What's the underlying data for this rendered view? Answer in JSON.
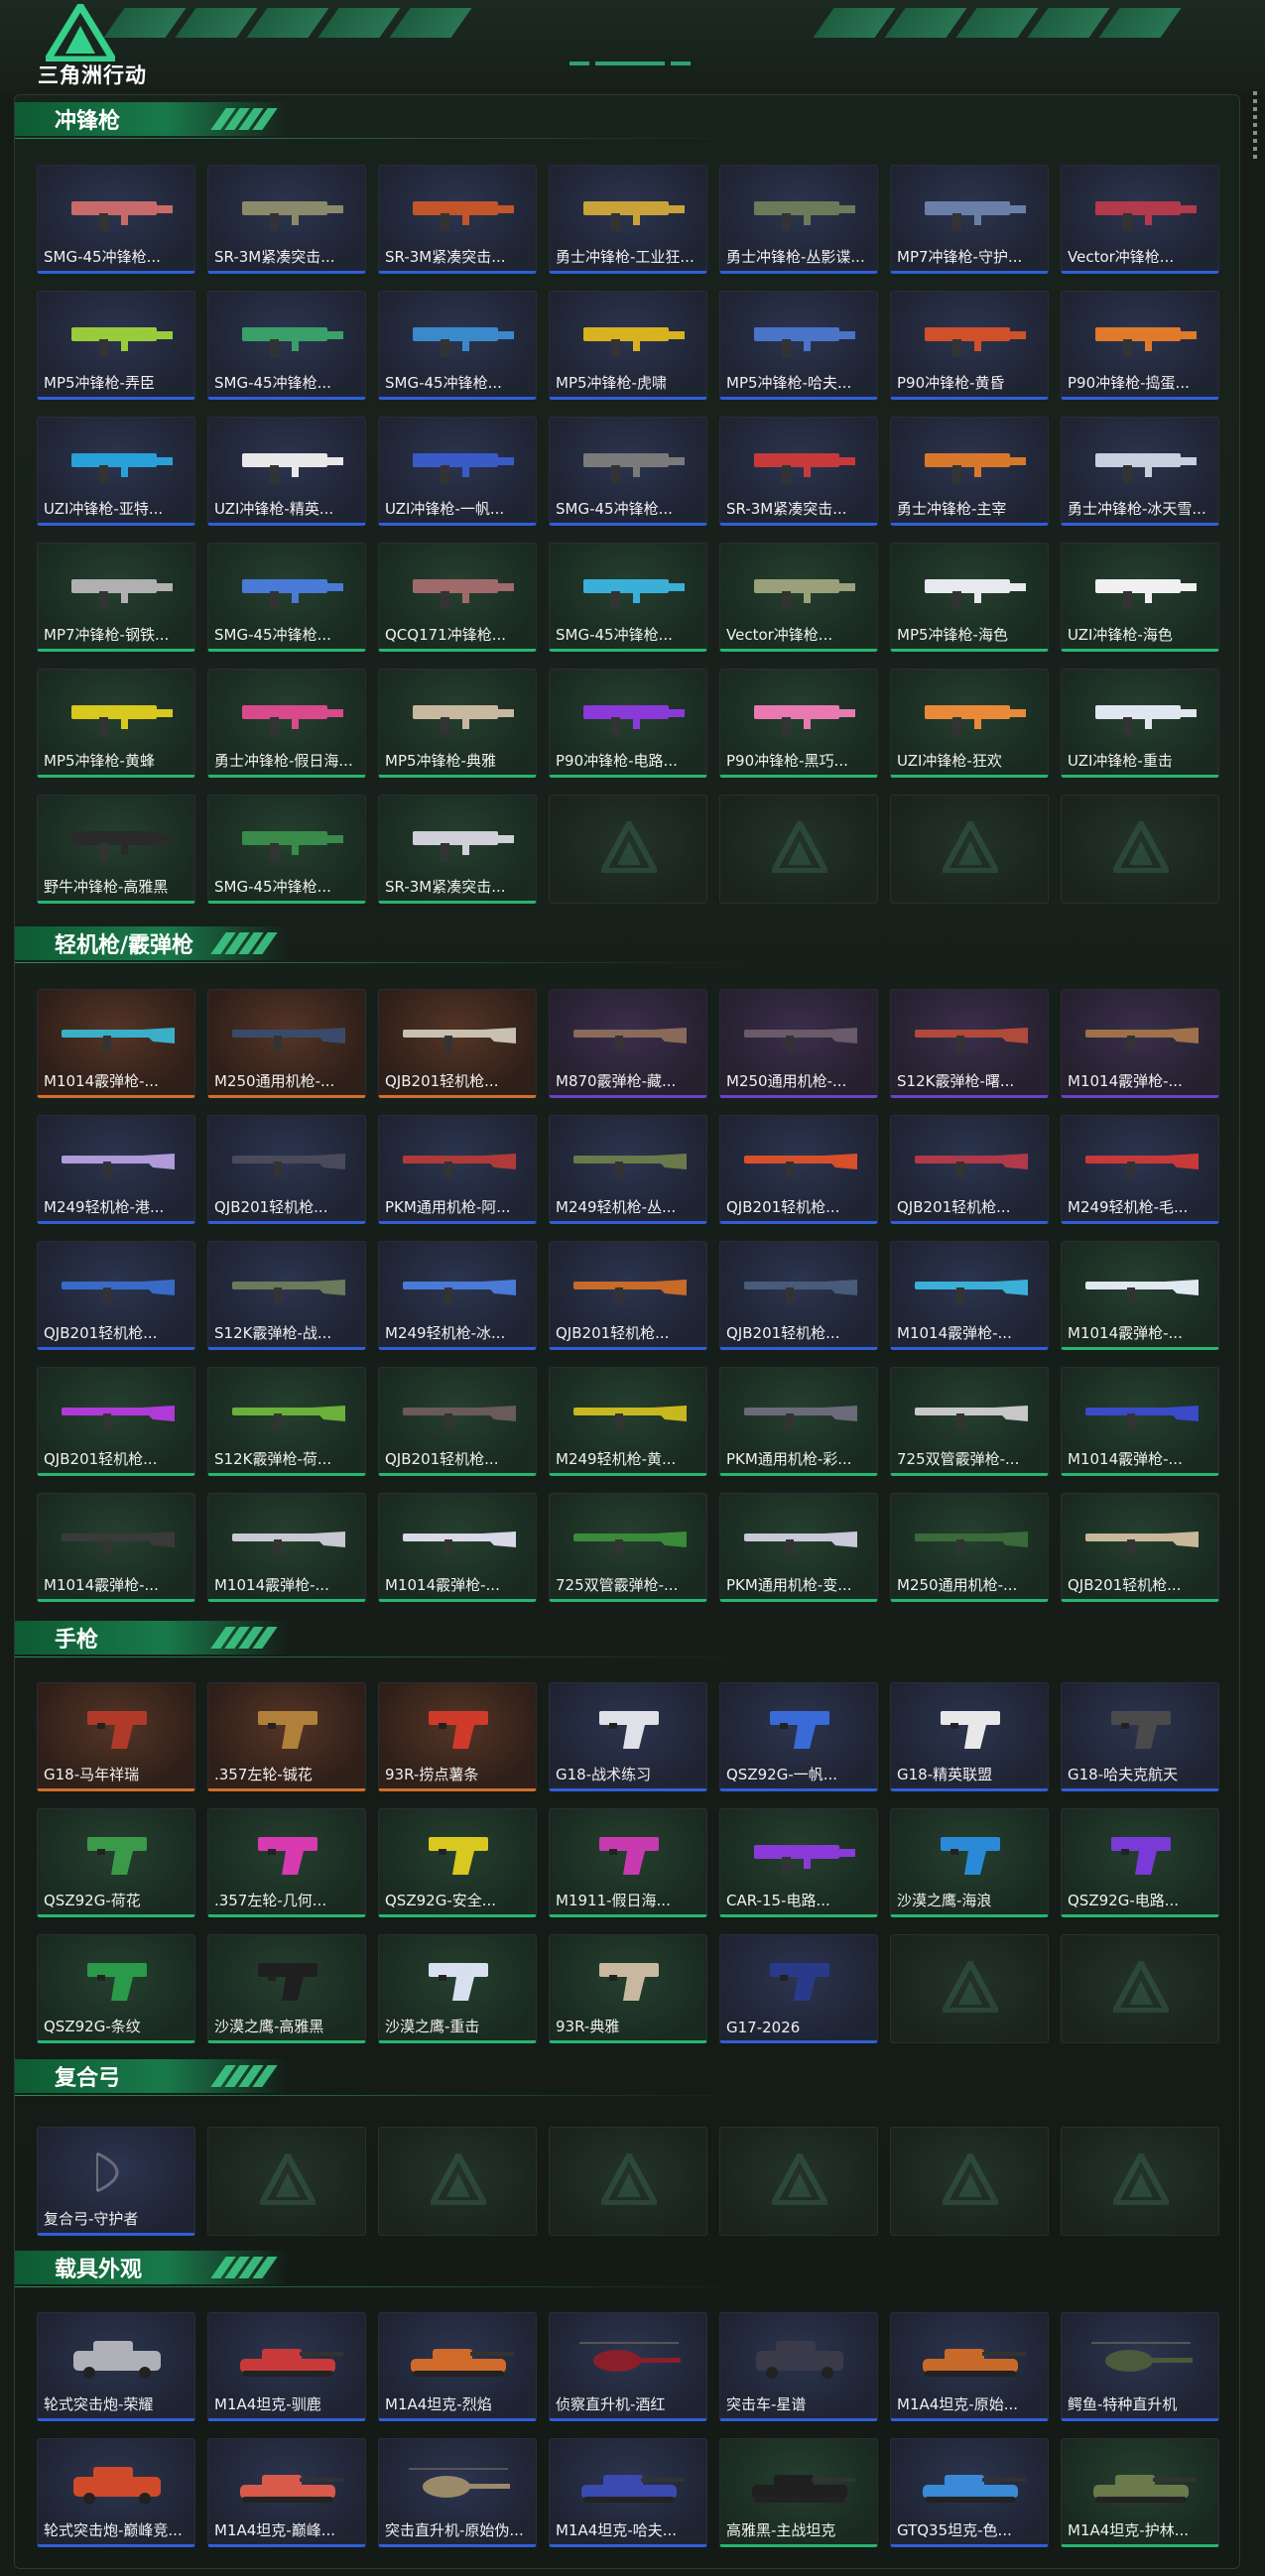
{
  "header": {
    "logo_text": "三角洲行动"
  },
  "colors": {
    "accent": "#2fa174",
    "section_bar": "#19794a",
    "rarity_purple": "#6a42c8",
    "rarity_blue": "#2f5fd8",
    "rarity_green": "#28b56f",
    "rarity_orange": "#d0702c",
    "rarity_gray": "#9a9fa6"
  },
  "sections": [
    {
      "title": "冲锋枪",
      "items": [
        {
          "label": "SMG-45冲锋枪...",
          "rarity": "blue",
          "icon": "smg-icon",
          "tint": "#c96a6a"
        },
        {
          "label": "SR-3M紧凑突击...",
          "rarity": "blue",
          "icon": "smg-icon",
          "tint": "#8a8a6a"
        },
        {
          "label": "SR-3M紧凑突击...",
          "rarity": "blue",
          "icon": "smg-icon",
          "tint": "#c2552a"
        },
        {
          "label": "勇士冲锋枪-工业狂...",
          "rarity": "blue",
          "icon": "smg-icon",
          "tint": "#c9a23a"
        },
        {
          "label": "勇士冲锋枪-丛影谍...",
          "rarity": "blue",
          "icon": "smg-icon",
          "tint": "#6c7a5a"
        },
        {
          "label": "MP7冲锋枪-守护...",
          "rarity": "blue",
          "icon": "smg-icon",
          "tint": "#6a7fa8"
        },
        {
          "label": "Vector冲锋枪...",
          "rarity": "blue",
          "icon": "smg-icon",
          "tint": "#b23a4a"
        },
        {
          "label": "MP5冲锋枪-弄臣",
          "rarity": "blue",
          "icon": "smg-icon",
          "tint": "#9acb3a"
        },
        {
          "label": "SMG-45冲锋枪...",
          "rarity": "blue",
          "icon": "smg-icon",
          "tint": "#3aa06a"
        },
        {
          "label": "SMG-45冲锋枪...",
          "rarity": "blue",
          "icon": "smg-icon",
          "tint": "#3a8acb"
        },
        {
          "label": "MP5冲锋枪-虎啸",
          "rarity": "blue",
          "icon": "smg-icon",
          "tint": "#d8b21f"
        },
        {
          "label": "MP5冲锋枪-哈夫...",
          "rarity": "blue",
          "icon": "smg-icon",
          "tint": "#4a74c8"
        },
        {
          "label": "P90冲锋枪-黄昏",
          "rarity": "blue",
          "icon": "smg-icon",
          "tint": "#d0502a"
        },
        {
          "label": "P90冲锋枪-捣蛋...",
          "rarity": "blue",
          "icon": "smg-icon",
          "tint": "#e07a2a"
        },
        {
          "label": "UZI冲锋枪-亚特...",
          "rarity": "blue",
          "icon": "smg-icon",
          "tint": "#2aa0d8"
        },
        {
          "label": "UZI冲锋枪-精英...",
          "rarity": "blue",
          "icon": "smg-icon",
          "tint": "#e8e8e8"
        },
        {
          "label": "UZI冲锋枪-一帆...",
          "rarity": "blue",
          "icon": "smg-icon",
          "tint": "#3a5ac8"
        },
        {
          "label": "SMG-45冲锋枪...",
          "rarity": "blue",
          "icon": "smg-icon",
          "tint": "#7a7a7a"
        },
        {
          "label": "SR-3M紧凑突击...",
          "rarity": "blue",
          "icon": "smg-icon",
          "tint": "#c83a3a"
        },
        {
          "label": "勇士冲锋枪-主宰",
          "rarity": "blue",
          "icon": "smg-icon",
          "tint": "#d8782a"
        },
        {
          "label": "勇士冲锋枪-冰天雪...",
          "rarity": "blue",
          "icon": "smg-icon",
          "tint": "#c8d0e0"
        },
        {
          "label": "MP7冲锋枪-钢铁...",
          "rarity": "green",
          "icon": "smg-icon",
          "tint": "#b0b0b0"
        },
        {
          "label": "SMG-45冲锋枪...",
          "rarity": "green",
          "icon": "smg-icon",
          "tint": "#4a7ad8"
        },
        {
          "label": "QCQ171冲锋枪...",
          "rarity": "green",
          "icon": "smg-icon",
          "tint": "#a06a6a"
        },
        {
          "label": "SMG-45冲锋枪...",
          "rarity": "green",
          "icon": "smg-icon",
          "tint": "#3ab0d8"
        },
        {
          "label": "Vector冲锋枪...",
          "rarity": "green",
          "icon": "smg-icon",
          "tint": "#9aa07a"
        },
        {
          "label": "MP5冲锋枪-海色",
          "rarity": "green",
          "icon": "smg-icon",
          "tint": "#e8e8f0"
        },
        {
          "label": "UZI冲锋枪-海色",
          "rarity": "green",
          "icon": "smg-icon",
          "tint": "#f0f0f0"
        },
        {
          "label": "MP5冲锋枪-黄蜂",
          "rarity": "green",
          "icon": "smg-icon",
          "tint": "#d8c81f"
        },
        {
          "label": "勇士冲锋枪-假日海...",
          "rarity": "green",
          "icon": "smg-icon",
          "tint": "#d84a8a"
        },
        {
          "label": "MP5冲锋枪-典雅",
          "rarity": "green",
          "icon": "smg-icon",
          "tint": "#c8b8a0"
        },
        {
          "label": "P90冲锋枪-电路...",
          "rarity": "green",
          "icon": "smg-icon",
          "tint": "#8a3ad8"
        },
        {
          "label": "P90冲锋枪-黑巧...",
          "rarity": "green",
          "icon": "smg-icon",
          "tint": "#e87ab0"
        },
        {
          "label": "UZI冲锋枪-狂欢",
          "rarity": "green",
          "icon": "smg-icon",
          "tint": "#e88a3a"
        },
        {
          "label": "UZI冲锋枪-重击",
          "rarity": "green",
          "icon": "smg-icon",
          "tint": "#e0e6f0"
        },
        {
          "label": "野牛冲锋枪-高雅黑",
          "rarity": "green",
          "icon": "smg-icon",
          "tint": "#2a2a2a"
        },
        {
          "label": "SMG-45冲锋枪...",
          "rarity": "green",
          "icon": "smg-icon",
          "tint": "#3a8a4a"
        },
        {
          "label": "SR-3M紧凑突击...",
          "rarity": "green",
          "icon": "smg-icon",
          "tint": "#d0d0d8"
        },
        {
          "label": "",
          "rarity": "empty"
        },
        {
          "label": "",
          "rarity": "empty"
        },
        {
          "label": "",
          "rarity": "empty"
        },
        {
          "label": "",
          "rarity": "empty"
        }
      ]
    },
    {
      "title": "轻机枪/霰弹枪",
      "items": [
        {
          "label": "M1014霰弹枪-...",
          "rarity": "orange",
          "icon": "shotgun-icon",
          "tint": "#3ab0c8"
        },
        {
          "label": "M250通用机枪-...",
          "rarity": "orange",
          "icon": "lmg-icon",
          "tint": "#3a4a6a"
        },
        {
          "label": "QJB201轻机枪...",
          "rarity": "orange",
          "icon": "lmg-icon",
          "tint": "#c8c0b0"
        },
        {
          "label": "M870霰弹枪-藏...",
          "rarity": "purple",
          "icon": "shotgun-icon",
          "tint": "#8a6a5a"
        },
        {
          "label": "M250通用机枪-...",
          "rarity": "purple",
          "icon": "lmg-icon",
          "tint": "#6a5a6a"
        },
        {
          "label": "S12K霰弹枪-曙...",
          "rarity": "purple",
          "icon": "shotgun-icon",
          "tint": "#b04a3a"
        },
        {
          "label": "M1014霰弹枪-...",
          "rarity": "purple",
          "icon": "shotgun-icon",
          "tint": "#a0704a"
        },
        {
          "label": "M249轻机枪-港...",
          "rarity": "blue",
          "icon": "lmg-icon",
          "tint": "#b09ad8"
        },
        {
          "label": "QJB201轻机枪...",
          "rarity": "blue",
          "icon": "lmg-icon",
          "tint": "#4a4a5a"
        },
        {
          "label": "PKM通用机枪-阿...",
          "rarity": "blue",
          "icon": "lmg-icon",
          "tint": "#b03a3a"
        },
        {
          "label": "M249轻机枪-丛...",
          "rarity": "blue",
          "icon": "lmg-icon",
          "tint": "#6a7a4a"
        },
        {
          "label": "QJB201轻机枪...",
          "rarity": "blue",
          "icon": "lmg-icon",
          "tint": "#d8502a"
        },
        {
          "label": "QJB201轻机枪...",
          "rarity": "blue",
          "icon": "lmg-icon",
          "tint": "#b03a4a"
        },
        {
          "label": "M249轻机枪-毛...",
          "rarity": "blue",
          "icon": "lmg-icon",
          "tint": "#c83a3a"
        },
        {
          "label": "QJB201轻机枪...",
          "rarity": "blue",
          "icon": "lmg-icon",
          "tint": "#3a6ac8"
        },
        {
          "label": "S12K霰弹枪-战...",
          "rarity": "blue",
          "icon": "shotgun-icon",
          "tint": "#6a7a5a"
        },
        {
          "label": "M249轻机枪-冰...",
          "rarity": "blue",
          "icon": "lmg-icon",
          "tint": "#4a7ad8"
        },
        {
          "label": "QJB201轻机枪...",
          "rarity": "blue",
          "icon": "lmg-icon",
          "tint": "#c86a2a"
        },
        {
          "label": "QJB201轻机枪...",
          "rarity": "blue",
          "icon": "lmg-icon",
          "tint": "#4a5a7a"
        },
        {
          "label": "M1014霰弹枪-...",
          "rarity": "blue",
          "icon": "shotgun-icon",
          "tint": "#3ab0d8"
        },
        {
          "label": "M1014霰弹枪-...",
          "rarity": "green",
          "icon": "shotgun-icon",
          "tint": "#e0e8f0"
        },
        {
          "label": "QJB201轻机枪...",
          "rarity": "green",
          "icon": "lmg-icon",
          "tint": "#b03ad8"
        },
        {
          "label": "S12K霰弹枪-荷...",
          "rarity": "green",
          "icon": "shotgun-icon",
          "tint": "#6ab03a"
        },
        {
          "label": "QJB201轻机枪...",
          "rarity": "green",
          "icon": "lmg-icon",
          "tint": "#6a5a5a"
        },
        {
          "label": "M249轻机枪-黄...",
          "rarity": "green",
          "icon": "lmg-icon",
          "tint": "#c8b81f"
        },
        {
          "label": "PKM通用机枪-彩...",
          "rarity": "green",
          "icon": "lmg-icon",
          "tint": "#6a6a7a"
        },
        {
          "label": "725双管霰弹枪-...",
          "rarity": "green",
          "icon": "shotgun-icon",
          "tint": "#c8c8c8"
        },
        {
          "label": "M1014霰弹枪-...",
          "rarity": "green",
          "icon": "shotgun-icon",
          "tint": "#3a4ac8"
        },
        {
          "label": "M1014霰弹枪-...",
          "rarity": "green",
          "icon": "shotgun-icon",
          "tint": "#3a3a3a"
        },
        {
          "label": "M1014霰弹枪-...",
          "rarity": "green",
          "icon": "shotgun-icon",
          "tint": "#c8c8d0"
        },
        {
          "label": "M1014霰弹枪-...",
          "rarity": "green",
          "icon": "shotgun-icon",
          "tint": "#d8d8e8"
        },
        {
          "label": "725双管霰弹枪-...",
          "rarity": "green",
          "icon": "shotgun-icon",
          "tint": "#3a8a3a"
        },
        {
          "label": "PKM通用机枪-变...",
          "rarity": "green",
          "icon": "lmg-icon",
          "tint": "#c8c8d8"
        },
        {
          "label": "M250通用机枪-...",
          "rarity": "green",
          "icon": "lmg-icon",
          "tint": "#3a6a3a"
        },
        {
          "label": "QJB201轻机枪...",
          "rarity": "green",
          "icon": "lmg-icon",
          "tint": "#c8b89a"
        }
      ]
    },
    {
      "title": "手枪",
      "items": [
        {
          "label": "G18-马年祥瑞",
          "rarity": "orange",
          "icon": "pistol-icon",
          "tint": "#b03a2a"
        },
        {
          "label": ".357左轮-铖花",
          "rarity": "orange",
          "icon": "revolver-icon",
          "tint": "#b0803a"
        },
        {
          "label": "93R-捞点薯条",
          "rarity": "orange",
          "icon": "pistol-icon",
          "tint": "#d03a2a"
        },
        {
          "label": "G18-战术练习",
          "rarity": "blue",
          "icon": "pistol-icon",
          "tint": "#e0e0e8"
        },
        {
          "label": "QSZ92G-一帆...",
          "rarity": "blue",
          "icon": "pistol-icon",
          "tint": "#3a6ad8"
        },
        {
          "label": "G18-精英联盟",
          "rarity": "blue",
          "icon": "pistol-icon",
          "tint": "#e8e8e8"
        },
        {
          "label": "G18-哈夫克航天",
          "rarity": "blue",
          "icon": "pistol-icon",
          "tint": "#4a4a4a"
        },
        {
          "label": "QSZ92G-荷花",
          "rarity": "green",
          "icon": "pistol-icon",
          "tint": "#3a9a4a"
        },
        {
          "label": ".357左轮-几何...",
          "rarity": "green",
          "icon": "revolver-icon",
          "tint": "#d83ab0"
        },
        {
          "label": "QSZ92G-安全...",
          "rarity": "green",
          "icon": "pistol-icon",
          "tint": "#d8c81f"
        },
        {
          "label": "M1911-假日海...",
          "rarity": "green",
          "icon": "pistol-icon",
          "tint": "#c83ab0"
        },
        {
          "label": "CAR-15-电路...",
          "rarity": "green",
          "icon": "smg-icon",
          "tint": "#8a3ad8"
        },
        {
          "label": "沙漠之鹰-海浪",
          "rarity": "green",
          "icon": "pistol-icon",
          "tint": "#2a8ad8"
        },
        {
          "label": "QSZ92G-电路...",
          "rarity": "green",
          "icon": "pistol-icon",
          "tint": "#7a3ad8"
        },
        {
          "label": "QSZ92G-条纹",
          "rarity": "green",
          "icon": "pistol-icon",
          "tint": "#2a9a4a"
        },
        {
          "label": "沙漠之鹰-高雅黑",
          "rarity": "green",
          "icon": "pistol-icon",
          "tint": "#1f1f1f"
        },
        {
          "label": "沙漠之鹰-重击",
          "rarity": "green",
          "icon": "pistol-icon",
          "tint": "#d8e0f0"
        },
        {
          "label": "93R-典雅",
          "rarity": "green",
          "icon": "pistol-icon",
          "tint": "#c8b8a0"
        },
        {
          "label": "G17-2026",
          "rarity": "blue",
          "icon": "pistol-icon",
          "tint": "#2a3a8a"
        },
        {
          "label": "",
          "rarity": "empty"
        },
        {
          "label": "",
          "rarity": "empty"
        }
      ]
    },
    {
      "title": "复合弓",
      "items": [
        {
          "label": "复合弓-守护者",
          "rarity": "blue",
          "icon": "bow-icon",
          "tint": "#6a6a7a"
        },
        {
          "label": "",
          "rarity": "empty"
        },
        {
          "label": "",
          "rarity": "empty"
        },
        {
          "label": "",
          "rarity": "empty"
        },
        {
          "label": "",
          "rarity": "empty"
        },
        {
          "label": "",
          "rarity": "empty"
        },
        {
          "label": "",
          "rarity": "empty"
        }
      ]
    },
    {
      "title": "载具外观",
      "items": [
        {
          "label": "轮式突击炮-荣耀",
          "rarity": "blue",
          "icon": "vehicle-icon",
          "tint": "#b0b0b8"
        },
        {
          "label": "M1A4坦克-驯鹿",
          "rarity": "blue",
          "icon": "tank-icon",
          "tint": "#c83a3a"
        },
        {
          "label": "M1A4坦克-烈焰",
          "rarity": "blue",
          "icon": "tank-icon",
          "tint": "#d06a2a"
        },
        {
          "label": "侦察直升机-酒红",
          "rarity": "blue",
          "icon": "helicopter-icon",
          "tint": "#8a1f2a"
        },
        {
          "label": "突击车-星谱",
          "rarity": "blue",
          "icon": "vehicle-icon",
          "tint": "#3a3a4a"
        },
        {
          "label": "M1A4坦克-原始...",
          "rarity": "blue",
          "icon": "tank-icon",
          "tint": "#c86a2a"
        },
        {
          "label": "鳄鱼-特种直升机",
          "rarity": "blue",
          "icon": "helicopter-icon",
          "tint": "#4a5a3a"
        },
        {
          "label": "轮式突击炮-巅峰竞...",
          "rarity": "blue",
          "icon": "vehicle-icon",
          "tint": "#d04a2a"
        },
        {
          "label": "M1A4坦克-巅峰...",
          "rarity": "blue",
          "icon": "tank-icon",
          "tint": "#d85a4a"
        },
        {
          "label": "突击直升机-原始伪...",
          "rarity": "blue",
          "icon": "helicopter-icon",
          "tint": "#9a8a6a"
        },
        {
          "label": "M1A4坦克-哈夫...",
          "rarity": "blue",
          "icon": "tank-icon",
          "tint": "#3a4ab0"
        },
        {
          "label": "高雅黑-主战坦克",
          "rarity": "green",
          "icon": "tank-icon",
          "tint": "#1f1f1f"
        },
        {
          "label": "GTQ35坦克-色...",
          "rarity": "blue",
          "icon": "tank-icon",
          "tint": "#3a8ad8"
        },
        {
          "label": "M1A4坦克-护林...",
          "rarity": "green",
          "icon": "tank-icon",
          "tint": "#6a7a4a"
        }
      ]
    }
  ]
}
